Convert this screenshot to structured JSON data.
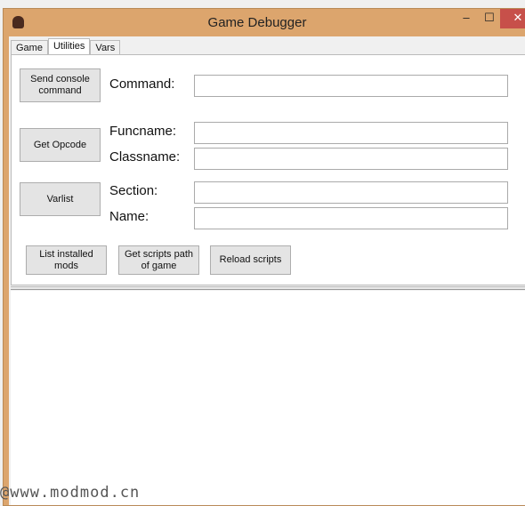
{
  "window": {
    "title": "Game Debugger",
    "min_label": "–",
    "max_label": "☐",
    "close_label": "✕"
  },
  "tabs": [
    {
      "label": "Game"
    },
    {
      "label": "Utilities",
      "active": true
    },
    {
      "label": "Vars"
    }
  ],
  "utilities": {
    "send_console_command": "Send console command",
    "command_label": "Command:",
    "command_value": "",
    "get_opcode": "Get Opcode",
    "funcname_label": "Funcname:",
    "funcname_value": "",
    "classname_label": "Classname:",
    "classname_value": "",
    "varlist": "Varlist",
    "section_label": "Section:",
    "section_value": "",
    "name_label": "Name:",
    "name_value": "",
    "list_installed_mods": "List installed mods",
    "get_scripts_path": "Get scripts path of game",
    "reload_scripts": "Reload scripts"
  },
  "watermark": "@www.modmod.cn"
}
